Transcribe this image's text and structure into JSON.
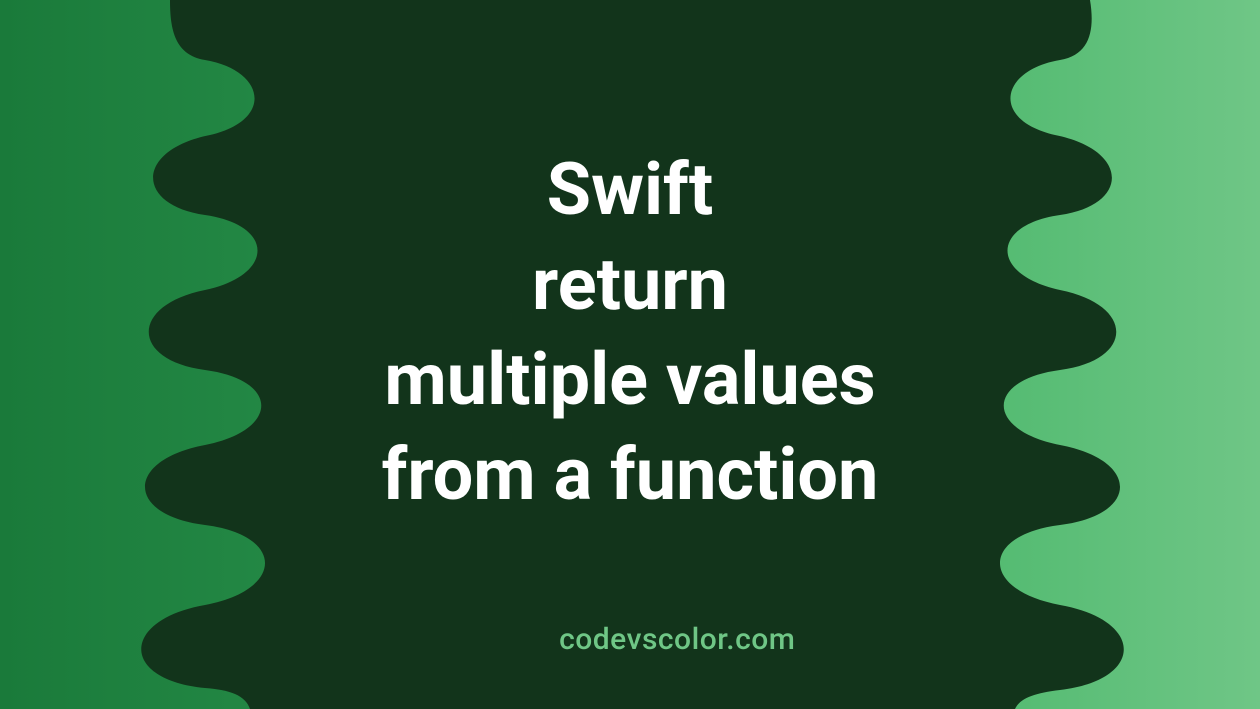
{
  "title_lines": "Swift\nreturn\nmultiple values\nfrom a function",
  "attribution": "codevscolor.com",
  "colors": {
    "blob_fill": "#12341b",
    "text": "#ffffff",
    "attribution": "#6fc686"
  }
}
